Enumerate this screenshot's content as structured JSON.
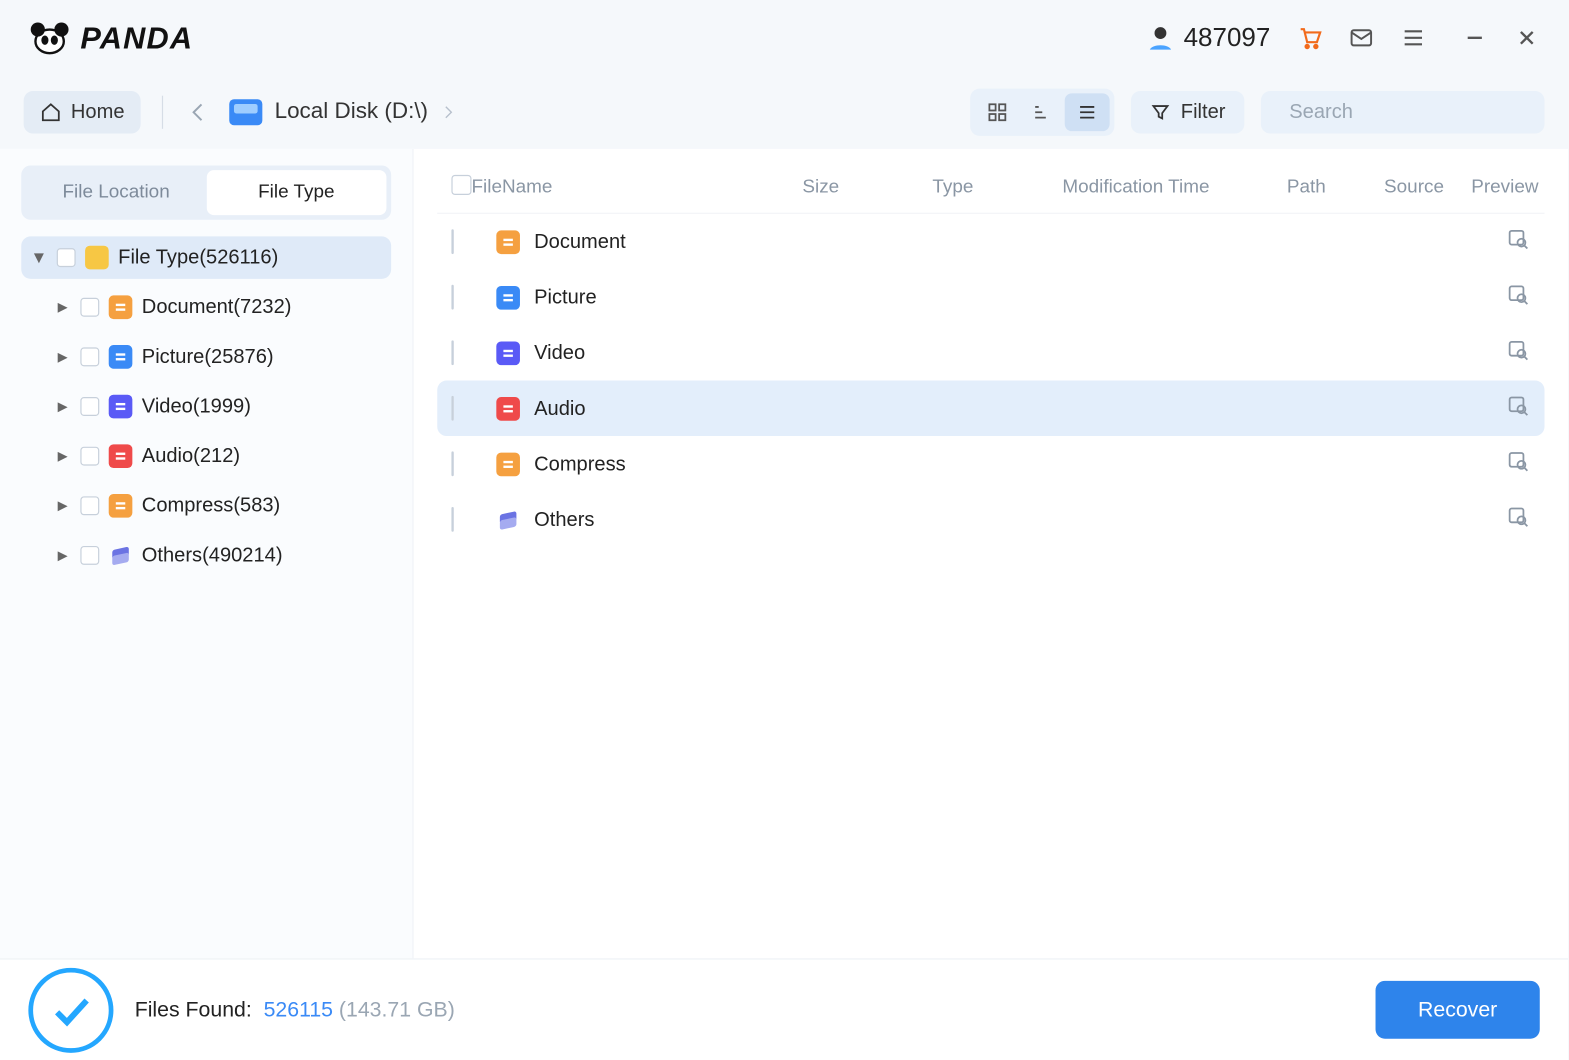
{
  "app": {
    "name": "PANDA"
  },
  "header": {
    "points": "487097"
  },
  "toolbar": {
    "home": "Home",
    "breadcrumb": "Local Disk (D:\\)",
    "filter": "Filter",
    "search_placeholder": "Search",
    "view_active": "list"
  },
  "sidebar": {
    "tabs": {
      "location": "File Location",
      "type": "File Type",
      "active": "type"
    },
    "root": {
      "label": "File Type",
      "count": "526116"
    },
    "items": [
      {
        "label": "Document",
        "count": "7232",
        "icon": "doc"
      },
      {
        "label": "Picture",
        "count": "25876",
        "icon": "pic"
      },
      {
        "label": "Video",
        "count": "1999",
        "icon": "vid"
      },
      {
        "label": "Audio",
        "count": "212",
        "icon": "aud"
      },
      {
        "label": "Compress",
        "count": "583",
        "icon": "zip"
      },
      {
        "label": "Others",
        "count": "490214",
        "icon": "oth"
      }
    ]
  },
  "table": {
    "columns": {
      "name": "FileName",
      "size": "Size",
      "type": "Type",
      "mtime": "Modification Time",
      "path": "Path",
      "source": "Source",
      "preview": "Preview"
    },
    "rows": [
      {
        "name": "Document",
        "icon": "doc"
      },
      {
        "name": "Picture",
        "icon": "pic"
      },
      {
        "name": "Video",
        "icon": "vid"
      },
      {
        "name": "Audio",
        "icon": "aud",
        "selected": true
      },
      {
        "name": "Compress",
        "icon": "zip"
      },
      {
        "name": "Others",
        "icon": "oth"
      }
    ]
  },
  "footer": {
    "label": "Files Found:",
    "count": "526115",
    "size": "(143.71 GB)",
    "recover": "Recover"
  }
}
